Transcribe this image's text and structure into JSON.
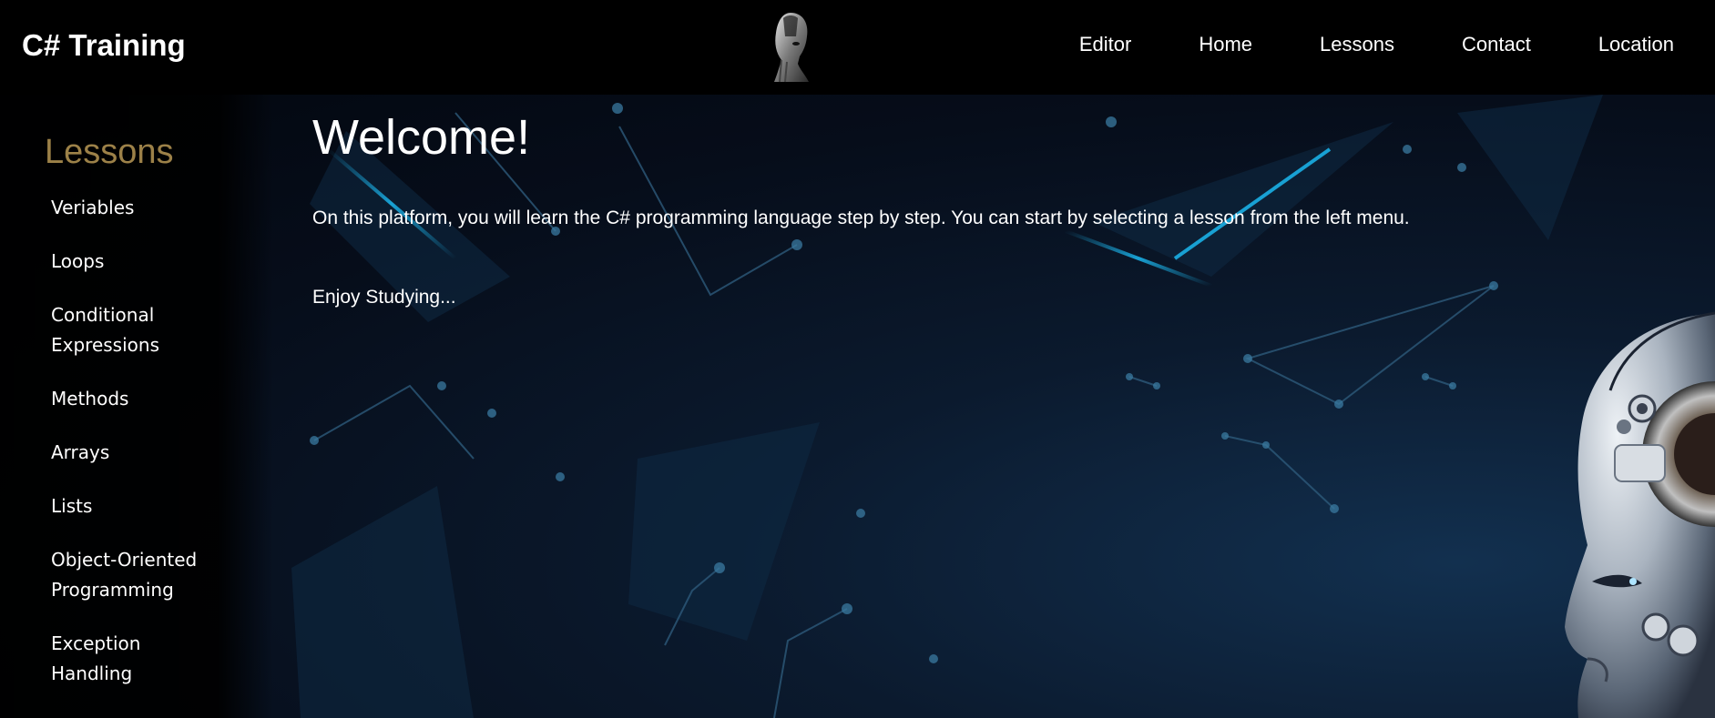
{
  "navbar": {
    "brand": "C# Training",
    "logo_icon": "robot-head-logo-icon",
    "links": [
      "Editor",
      "Home",
      "Lessons",
      "Contact",
      "Location"
    ]
  },
  "sidebar": {
    "title": "Lessons",
    "items": [
      "Veriables",
      "Loops",
      "Conditional Expressions",
      "Methods",
      "Arrays",
      "Lists",
      "Object-Oriented Programming",
      "Exception Handling"
    ]
  },
  "main": {
    "heading": "Welcome!",
    "intro": "On this platform, you will learn the C# programming language step by step. You can start by selecting a lesson from the left menu.",
    "outro": "Enjoy Studying..."
  },
  "colors": {
    "navbar_bg": "#000000",
    "sidebar_title": "#9c8148",
    "text": "#ffffff",
    "hero_accent": "#1aa3d6"
  }
}
